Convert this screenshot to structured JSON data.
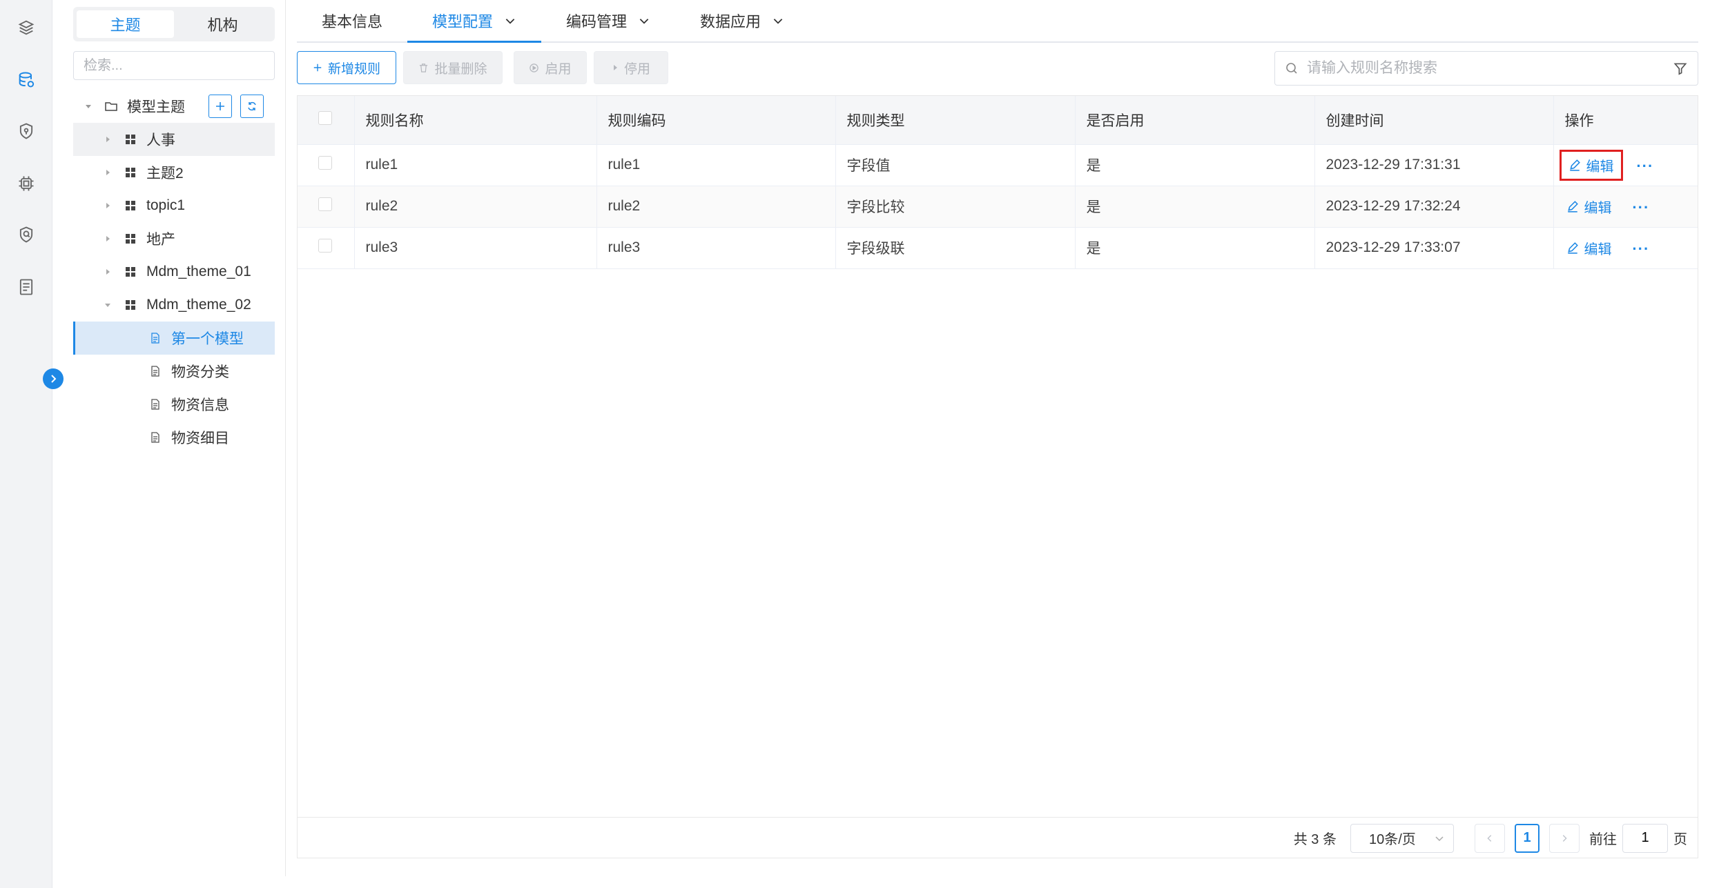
{
  "rail": {
    "icons": [
      "layers-icon",
      "database-icon",
      "shield-icon",
      "chip-icon",
      "security-icon",
      "document-list-icon"
    ]
  },
  "tree": {
    "segment": {
      "topic": "主题",
      "org": "机构"
    },
    "search_placeholder": "检索...",
    "root_label": "模型主题",
    "nodes": [
      {
        "label": "人事"
      },
      {
        "label": "主题2"
      },
      {
        "label": "topic1"
      },
      {
        "label": "地产"
      },
      {
        "label": "Mdm_theme_01"
      },
      {
        "label": "Mdm_theme_02"
      }
    ],
    "children": [
      {
        "label": "第一个模型"
      },
      {
        "label": "物资分类"
      },
      {
        "label": "物资信息"
      },
      {
        "label": "物资细目"
      }
    ]
  },
  "tabs": [
    {
      "label": "基本信息"
    },
    {
      "label": "模型配置"
    },
    {
      "label": "编码管理"
    },
    {
      "label": "数据应用"
    }
  ],
  "toolbar": {
    "add": "新增规则",
    "batch_delete": "批量删除",
    "enable": "启用",
    "disable": "停用",
    "search_placeholder": "请输入规则名称搜索"
  },
  "table": {
    "columns": [
      "规则名称",
      "规则编码",
      "规则类型",
      "是否启用",
      "创建时间",
      "操作"
    ],
    "rows": [
      {
        "name": "rule1",
        "code": "rule1",
        "type": "字段值",
        "enabled": "是",
        "created": "2023-12-29 17:31:31"
      },
      {
        "name": "rule2",
        "code": "rule2",
        "type": "字段比较",
        "enabled": "是",
        "created": "2023-12-29 17:32:24"
      },
      {
        "name": "rule3",
        "code": "rule3",
        "type": "字段级联",
        "enabled": "是",
        "created": "2023-12-29 17:33:07"
      }
    ],
    "edit_label": "编辑",
    "more_label": "···"
  },
  "pager": {
    "total": "共 3 条",
    "page_size": "10条/页",
    "current": "1",
    "goto_prefix": "前往",
    "goto_value": "1",
    "goto_suffix": "页"
  },
  "colors": {
    "accent": "#1e88e5",
    "highlight": "#e02020"
  }
}
